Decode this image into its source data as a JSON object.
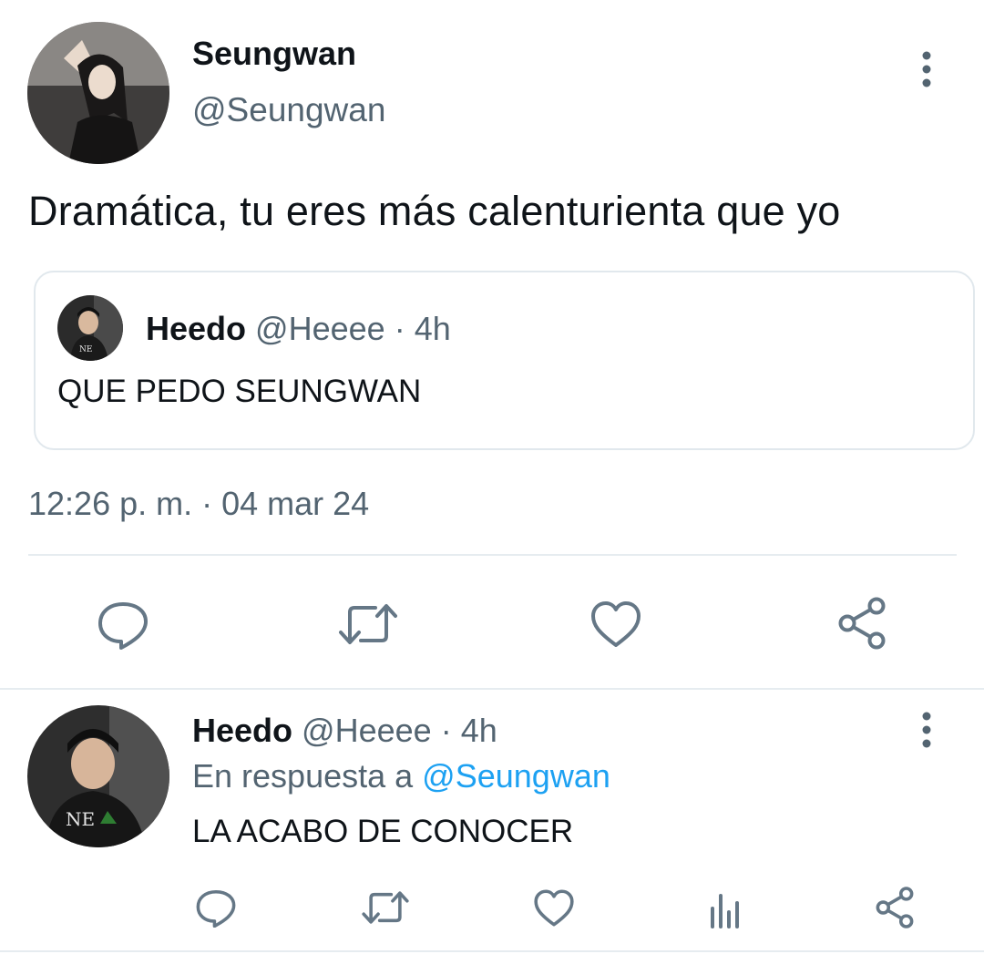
{
  "tweet": {
    "author_name": "Seungwan",
    "author_handle": "@Seungwan",
    "text": "Dramática, tu eres más calenturienta que yo",
    "quoted": {
      "author_name": "Heedo",
      "author_handle": "@Heeee",
      "separator": "·",
      "time": "4h",
      "text": "QUE PEDO SEUNGWAN"
    },
    "timestamp": "12:26 p. m. · 04 mar 24",
    "actions": [
      "reply-icon",
      "retweet-icon",
      "like-icon",
      "share-icon"
    ]
  },
  "reply": {
    "author_name": "Heedo",
    "author_handle": "@Heeee",
    "separator": "·",
    "time": "4h",
    "in_reply_prefix": "En respuesta a",
    "in_reply_mention": "@Seungwan",
    "text": "LA ACABO DE CONOCER",
    "actions": [
      "reply-icon",
      "retweet-icon",
      "like-icon",
      "analytics-icon",
      "share-icon"
    ]
  },
  "colors": {
    "icon": "#657786",
    "muted_text": "#536471",
    "mention": "#1da1f2",
    "border": "#e1e8ed"
  }
}
